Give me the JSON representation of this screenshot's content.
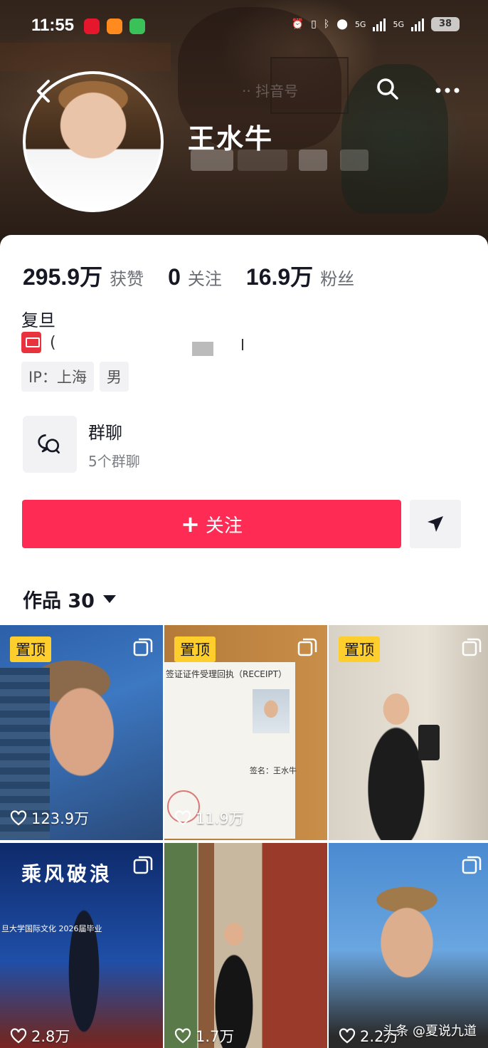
{
  "status_bar": {
    "time": "11:55",
    "network_1": "5G",
    "network_2": "5G",
    "battery": "38"
  },
  "header": {
    "username": "王水牛",
    "watermark": "·· 抖音号"
  },
  "stats": [
    {
      "value": "295.9万",
      "label": "获赞"
    },
    {
      "value": "0",
      "label": "关注"
    },
    {
      "value": "16.9万",
      "label": "粉丝"
    }
  ],
  "profile": {
    "bio": "复旦",
    "mailbox_char": "(",
    "tags": [
      "IP：上海",
      "男"
    ]
  },
  "group_chat": {
    "title": "群聊",
    "subtitle": "5个群聊"
  },
  "actions": {
    "follow_label": "关注"
  },
  "works_tab": {
    "label": "作品 30"
  },
  "videos": [
    {
      "pinned": "置顶",
      "likes": "123.9万"
    },
    {
      "pinned": "置顶",
      "likes": "11.9万",
      "doc_title": "签证证件受理回执（RECEIPT）",
      "doc_sign": "签名：王水牛"
    },
    {
      "pinned": "置顶",
      "likes": ""
    },
    {
      "likes": "2.8万",
      "banner_1": "乘风破浪",
      "banner_2": "旦大学国际文化 2026届毕业"
    },
    {
      "likes": "1.7万"
    },
    {
      "likes": "2.2万"
    }
  ],
  "footer": {
    "source_mark": "头条 @夏说九道"
  },
  "colors": {
    "accent": "#fe2c55",
    "pin_badge": "#fece2c",
    "text_primary": "#161823",
    "text_secondary": "#6b6d74"
  }
}
